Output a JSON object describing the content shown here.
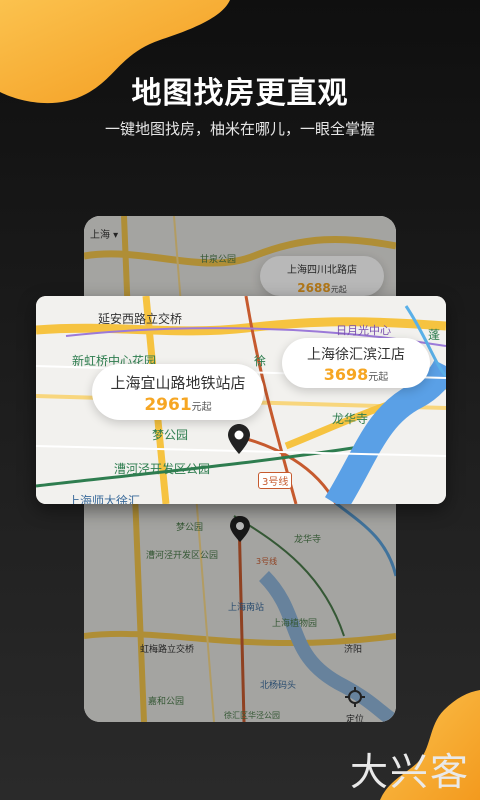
{
  "hero": {
    "title": "地图找房更直观",
    "subtitle": "一键地图找房，柚米在哪儿，一眼全掌握"
  },
  "map_preview": {
    "city_selector": "上海",
    "districts": [
      "甘泉公园",
      "梦公园",
      "漕河泾开发区公园",
      "上海南站",
      "上海植物园",
      "虹梅路立交桥",
      "嘉和公园",
      "北杨码头",
      "徐汇区华泾公园",
      "龙华寺",
      "3号线",
      "济阳"
    ],
    "store_card": {
      "name": "上海四川北路店",
      "price": "2688",
      "unit": "元起"
    },
    "locate_label": "定位"
  },
  "zoom_map": {
    "places": [
      "延安西路立交桥",
      "新虹桥中心花园",
      "日月光中心",
      "梦公园",
      "漕河泾开发区公园",
      "上海师大徐汇",
      "龙华寺",
      "3号线",
      "徐",
      "蓬"
    ],
    "stores": [
      {
        "name": "上海宜山路地铁站店",
        "price": "2961",
        "unit": "元起"
      },
      {
        "name": "上海徐汇滨江店",
        "price": "3698",
        "unit": "元起"
      }
    ]
  },
  "colors": {
    "accent": "#f6a623",
    "blob": "#f7b23b"
  },
  "watermark": "大兴客"
}
